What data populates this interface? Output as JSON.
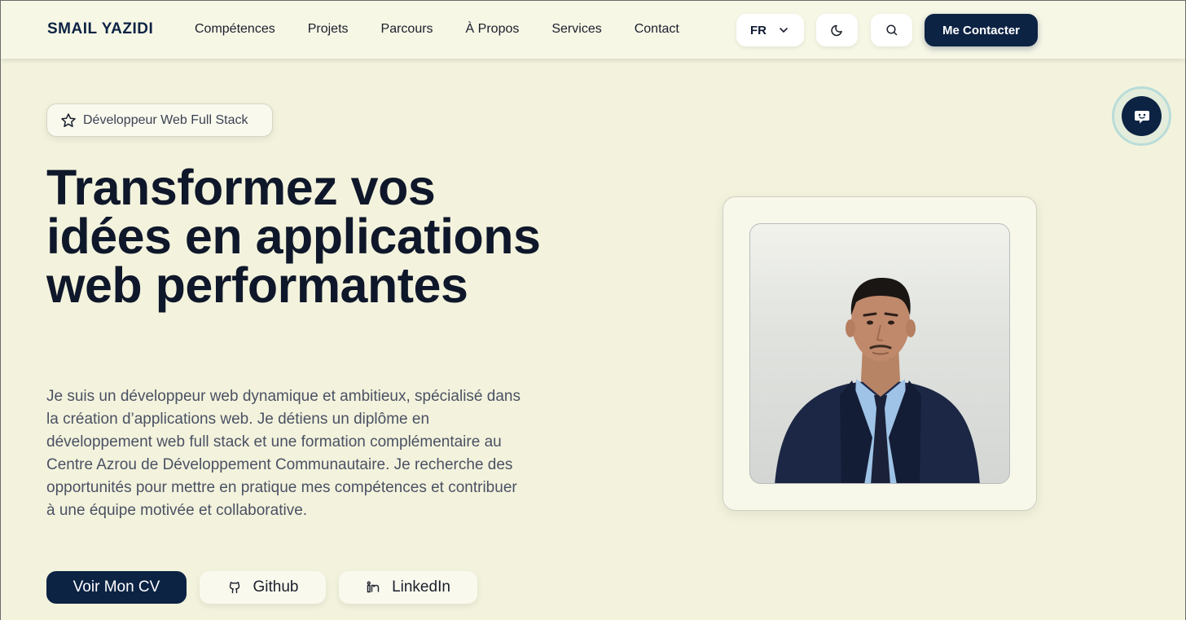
{
  "header": {
    "brand": "SMAIL YAZIDI",
    "nav": [
      "Compétences",
      "Projets",
      "Parcours",
      "À Propos",
      "Services",
      "Contact"
    ],
    "language": "FR",
    "contact_button": "Me Contacter",
    "icons": [
      "chevron-down-icon",
      "moon-icon",
      "search-icon"
    ]
  },
  "hero": {
    "badge": "Développeur Web Full Stack",
    "title": "Transformez vos idées en applications web performantes",
    "description": "Je suis un développeur web dynamique et ambitieux, spécialisé dans la création d’applications web. Je détiens un diplôme en développement web full stack et une formation complémentaire au Centre Azrou de Développement Communautaire. Je recherche des opportunités pour mettre en pratique mes compétences et contribuer à une équipe motivée et collaborative.",
    "buttons": {
      "cv": "Voir Mon CV",
      "github": "Github",
      "linkedin": "LinkedIn"
    }
  },
  "colors": {
    "background": "#f3f3dd",
    "primary": "#0d2344",
    "chat_ring": "#b9dcd8"
  }
}
